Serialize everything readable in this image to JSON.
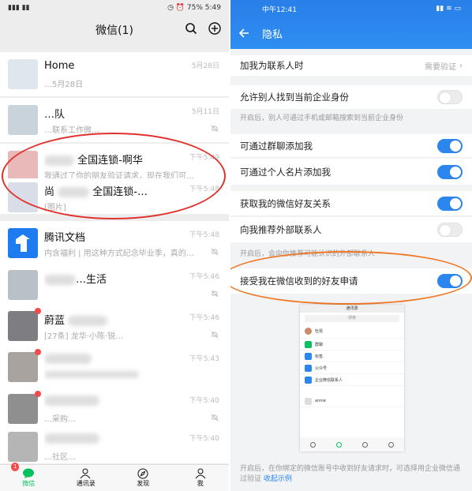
{
  "left": {
    "status": {
      "battery": "75%",
      "time": "5:49"
    },
    "title": "微信(1)",
    "chats": [
      {
        "name": "Home",
        "preview": "…5月28日",
        "time": "5月28日"
      },
      {
        "name": "…队",
        "preview": "…联系工作微…",
        "time": "5月11日"
      },
      {
        "name": "全国连锁-啊华",
        "preview": "我通过了你的朋友验证请求，现在我们可…",
        "time": "下午5:49"
      },
      {
        "name": "全国连锁-…",
        "preview": "[图片]",
        "time": "下午5:48"
      },
      {
        "name": "腾讯文档",
        "preview": "内含福利 | 用这种方式纪念毕业季，真的…",
        "time": "下午5:48"
      },
      {
        "name": "…生活",
        "preview": "",
        "time": "下午5:46"
      },
      {
        "name": "蔚蓝",
        "preview": "[27条] 龙华·小陈·锐…",
        "time": "下午5:46"
      },
      {
        "name": "",
        "preview": "",
        "time": "下午5:43"
      },
      {
        "name": "",
        "preview": "…采购…",
        "time": "下午5:40"
      },
      {
        "name": "",
        "preview": "…社区…",
        "time": "下午5:40"
      }
    ],
    "tabs": [
      {
        "label": "微信",
        "badge": "1"
      },
      {
        "label": "通讯录"
      },
      {
        "label": "发现"
      },
      {
        "label": "我"
      }
    ]
  },
  "right": {
    "status": {
      "time": "中午12:41"
    },
    "title": "隐私",
    "rows": {
      "add_as_contact": "加我为联系人时",
      "add_as_contact_value": "需要验证",
      "find_identity": "允许别人找到当前企业身份",
      "find_identity_note": "开启后，别人可通过手机或邮箱搜索到当前企业身份",
      "via_group": "可通过群聊添加我",
      "via_card": "可通过个人名片添加我",
      "get_wechat_friends": "获取我的微信好友关系",
      "recommend_external": "向我推荐外部联系人",
      "recommend_note": "开启后，会向你推荐可能认识的外部联系人",
      "accept_requests": "接受我在微信收到的好友申请"
    },
    "mini": {
      "header": "通讯录",
      "search": "搜索",
      "contact": "杜昆",
      "items": [
        "群聊",
        "标签",
        "公众号",
        "企业微信联系人"
      ],
      "bottom": "annie"
    },
    "footer": "开启后，在你绑定的微信账号中收到好友请求时，可选择用企业微信通过验证",
    "footer_link": "收起示例"
  },
  "colors": {
    "wechat_green": "#07c160",
    "wework_blue": "#2b86ee",
    "red_ellipse": "#e0322d",
    "orange_ellipse": "#f07a2a"
  }
}
